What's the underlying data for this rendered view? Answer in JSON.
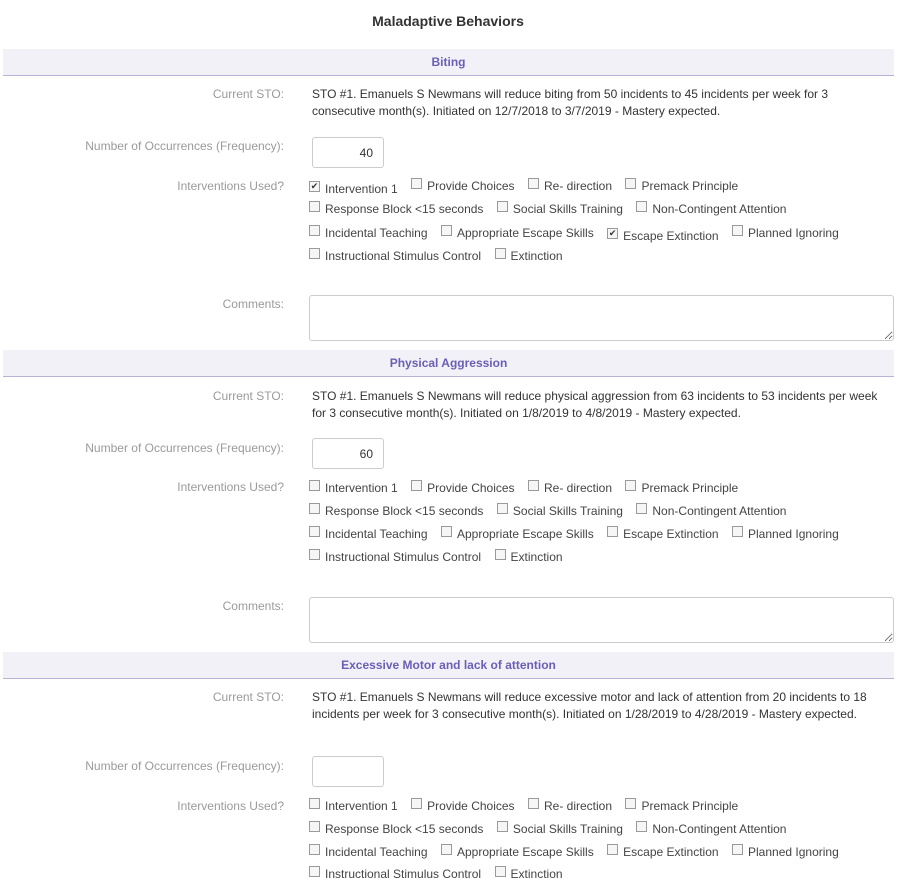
{
  "page": {
    "title": "Maladaptive Behaviors"
  },
  "labels": {
    "current_sto": "Current STO:",
    "frequency": "Number of Occurrences (Frequency):",
    "interventions": "Interventions Used?",
    "comments": "Comments:"
  },
  "sections": [
    {
      "title": "Biting",
      "sto": "STO #1. Emanuels S Newmans will reduce biting from 50 incidents to 45 incidents per week for 3 consecutive month(s). Initiated on 12/7/2018 to 3/7/2019 - Mastery expected.",
      "frequency": "40",
      "interventions": [
        {
          "label": "Intervention 1",
          "checked": true
        },
        {
          "label": "Provide Choices",
          "checked": false
        },
        {
          "label": "Re- direction",
          "checked": false
        },
        {
          "label": "Premack Principle",
          "checked": false
        },
        {
          "label": "Response Block <15 seconds",
          "checked": false
        },
        {
          "label": "Social Skills Training",
          "checked": false
        },
        {
          "label": "Non-Contingent Attention",
          "checked": false
        },
        {
          "label": "Incidental Teaching",
          "checked": false
        },
        {
          "label": "Appropriate Escape Skills",
          "checked": false
        },
        {
          "label": "Escape Extinction",
          "checked": true
        },
        {
          "label": "Planned Ignoring",
          "checked": false
        },
        {
          "label": "Instructional Stimulus Control",
          "checked": false
        },
        {
          "label": "Extinction",
          "checked": false
        }
      ],
      "comments": ""
    },
    {
      "title": "Physical Aggression",
      "sto": "STO #1. Emanuels S Newmans will reduce physical aggression from 63 incidents to 53 incidents per week for 3 consecutive month(s). Initiated on 1/8/2019 to 4/8/2019 - Mastery expected.",
      "frequency": "60",
      "interventions": [
        {
          "label": "Intervention 1",
          "checked": false
        },
        {
          "label": "Provide Choices",
          "checked": false
        },
        {
          "label": "Re- direction",
          "checked": false
        },
        {
          "label": "Premack Principle",
          "checked": false
        },
        {
          "label": "Response Block <15 seconds",
          "checked": false
        },
        {
          "label": "Social Skills Training",
          "checked": false
        },
        {
          "label": "Non-Contingent Attention",
          "checked": false
        },
        {
          "label": "Incidental Teaching",
          "checked": false
        },
        {
          "label": "Appropriate Escape Skills",
          "checked": false
        },
        {
          "label": "Escape Extinction",
          "checked": false
        },
        {
          "label": "Planned Ignoring",
          "checked": false
        },
        {
          "label": "Instructional Stimulus Control",
          "checked": false
        },
        {
          "label": "Extinction",
          "checked": false
        }
      ],
      "comments": ""
    },
    {
      "title": "Excessive Motor and lack of attention",
      "sto": "STO #1. Emanuels S Newmans will reduce excessive motor and lack of attention from 20 incidents to 18 incidents per week for 3 consecutive month(s). Initiated on 1/28/2019 to 4/28/2019 - Mastery expected.",
      "frequency": "",
      "interventions": [
        {
          "label": "Intervention 1",
          "checked": false
        },
        {
          "label": "Provide Choices",
          "checked": false
        },
        {
          "label": "Re- direction",
          "checked": false
        },
        {
          "label": "Premack Principle",
          "checked": false
        },
        {
          "label": "Response Block <15 seconds",
          "checked": false
        },
        {
          "label": "Social Skills Training",
          "checked": false
        },
        {
          "label": "Non-Contingent Attention",
          "checked": false
        },
        {
          "label": "Incidental Teaching",
          "checked": false
        },
        {
          "label": "Appropriate Escape Skills",
          "checked": false
        },
        {
          "label": "Escape Extinction",
          "checked": false
        },
        {
          "label": "Planned Ignoring",
          "checked": false
        },
        {
          "label": "Instructional Stimulus Control",
          "checked": false
        },
        {
          "label": "Extinction",
          "checked": false
        }
      ],
      "comments": ""
    }
  ]
}
